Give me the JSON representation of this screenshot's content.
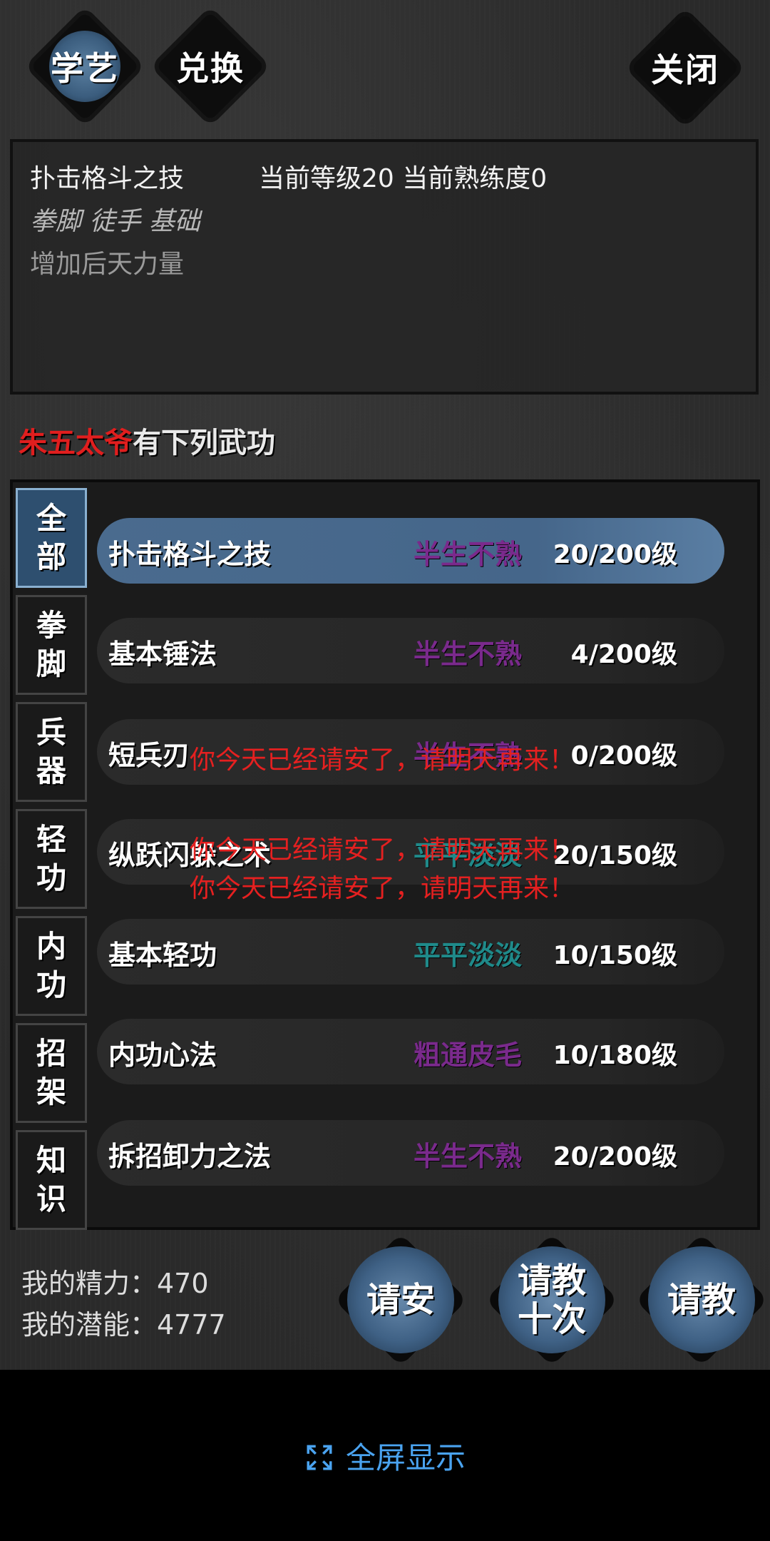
{
  "top": {
    "learn_label": "学艺",
    "exchange_label": "兑换",
    "close_label": "关闭"
  },
  "description": {
    "title": "扑击格斗之技",
    "level_info": "当前等级20  当前熟练度0",
    "tags": "拳脚 徒手 基础",
    "effect": "增加后天力量"
  },
  "master": {
    "name": "朱五太爷",
    "suffix": "有下列武功"
  },
  "categories": [
    {
      "line1": "全",
      "line2": "部"
    },
    {
      "line1": "拳",
      "line2": "脚"
    },
    {
      "line1": "兵",
      "line2": "器"
    },
    {
      "line1": "轻",
      "line2": "功"
    },
    {
      "line1": "内",
      "line2": "功"
    },
    {
      "line1": "招",
      "line2": "架"
    },
    {
      "line1": "知",
      "line2": "识"
    }
  ],
  "skills": [
    {
      "name": "扑击格斗之技",
      "proficiency": "半生不熟",
      "level": "20/200级",
      "color": "#7a2a8c"
    },
    {
      "name": "基本锤法",
      "proficiency": "半生不熟",
      "level": "4/200级",
      "color": "#7a2a8c"
    },
    {
      "name": "短兵刃",
      "proficiency": "半生不熟",
      "level": "0/200级",
      "color": "#7a2a8c"
    },
    {
      "name": "纵跃闪躲之术",
      "proficiency": "平平淡淡",
      "level": "20/150级",
      "color": "#1f8a8a"
    },
    {
      "name": "基本轻功",
      "proficiency": "平平淡淡",
      "level": "10/150级",
      "color": "#1f8a8a"
    },
    {
      "name": "内功心法",
      "proficiency": "粗通皮毛",
      "level": "10/180级",
      "color": "#7a2a8c"
    },
    {
      "name": "拆招卸力之法",
      "proficiency": "半生不熟",
      "level": "20/200级",
      "color": "#7a2a8c"
    }
  ],
  "toasts": [
    "你今天已经请安了，请明天再来！",
    "你今天已经请安了，请明天再来！",
    "你今天已经请安了，请明天再来！"
  ],
  "stats": {
    "energy": "我的精力：470",
    "potential": "我的潜能：4777"
  },
  "actions": {
    "greet": "请安",
    "ask_ten_line1": "请教",
    "ask_ten_line2": "十次",
    "ask": "请教"
  },
  "system": {
    "fullscreen_label": "全屏显示"
  }
}
